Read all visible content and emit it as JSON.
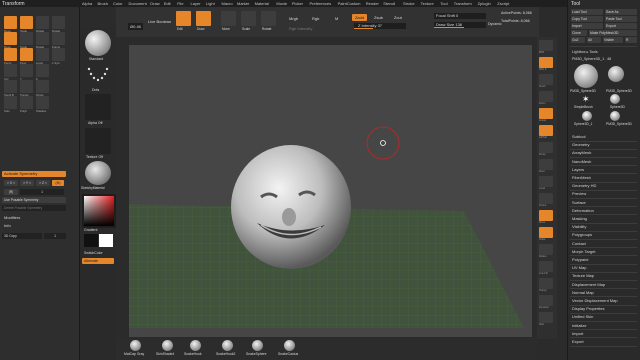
{
  "app": {
    "panel_title": "Transform",
    "right_panel_title": "Tool"
  },
  "menubar": {
    "items": [
      "Alpha",
      "Brush",
      "Color",
      "Document",
      "Draw",
      "Edit",
      "File",
      "Layer",
      "Light",
      "Macro",
      "Marker",
      "Material",
      "Movie",
      "Picker",
      "Preferences",
      "PaintCustom",
      "Render",
      "Stencil",
      "Stroke",
      "Texture",
      "Tool",
      "Transform",
      "Zplugin",
      "Zscript"
    ]
  },
  "left_panel": {
    "buttons": [
      "Move",
      "Scale",
      "Rotate",
      "Rotate",
      "Move",
      "Scale",
      "Rotate",
      "Frame",
      "Persp",
      "Floor",
      "Local",
      "L.Sym",
      "Xyz",
      "Y",
      "Z",
      "Spotlt B",
      "Transp",
      "Ghost",
      "Solo",
      "PolyF",
      "Shadow"
    ],
    "activate_symmetry": "Activate Symmetry",
    "axes": [
      "> X <",
      "> Y <",
      "> Z <",
      "(M)"
    ],
    "radial": "(R)",
    "radial_count": "1",
    "use_posable": "Use Posable Symmetry",
    "delete_posable": "Delete Posable Symmetry",
    "modifiers": "Modifiers",
    "info": "Info",
    "copy_label": "3D Copy",
    "copy_value": "1"
  },
  "tool_column": {
    "brush": "Standard",
    "stroke": "Dots",
    "alpha": "Alpha Off",
    "texture": "Texture Off",
    "material": "SketchyMaterial",
    "gradient": "Gradient",
    "switch_color": "SwitchColor",
    "alternate": "Alternate"
  },
  "top_bar": {
    "foot": "Ø0.46",
    "live_boolean": "Live Boolean",
    "modes": [
      "Edit",
      "Draw",
      "Move",
      "Scale",
      "Rotate"
    ],
    "mrgb": "Mrgb",
    "rgb": "Rgb",
    "m": "M",
    "zadd": "Zadd",
    "zsub": "Zsub",
    "zcut": "Zcut",
    "rgb_intensity": "Rgb Intensity",
    "z_intensity": "Z Intensity 37",
    "focal_shift": "Focal Shift 0",
    "draw_size": "Draw Size 136",
    "dynamic": "Dynamic",
    "active_points": "ActivePoints: 8,066",
    "total_points": "TotalPoints: 8,066"
  },
  "right_shelf": {
    "items": [
      "BPR",
      "SPix 3",
      "Scroll",
      "Zoom",
      "Actual",
      "AAHalf",
      "Persp",
      "Floor",
      "Local",
      "Frame",
      "Move",
      "Scale",
      "Rotate",
      "Line Fill",
      "Transp",
      "Dynamic",
      "Solo"
    ]
  },
  "right_panel": {
    "top_buttons": [
      "Load Tool",
      "Save As",
      "Copy Tool",
      "Paste Tool",
      "Import",
      "Export",
      "Clone",
      "Make PolyMesh3D",
      "GoZ",
      "All",
      "Visible",
      "R"
    ],
    "lightbox": "Lightbox ▸ Tools",
    "current_tool": "PM3D_Sphere3D_1 . 48",
    "thumbs": [
      "PM3D_Sphere3D",
      "SimpleBrush",
      "PM3D_Sphere3D",
      "Sphere3D",
      "Sphere3D_1",
      "PM3D_Sphere3D"
    ],
    "sections": [
      "Subtool",
      "Geometry",
      "ArrayMesh",
      "NanoMesh",
      "Layers",
      "FiberMesh",
      "Geometry HD",
      "Preview",
      "Surface",
      "Deformation",
      "Masking",
      "Visibility",
      "Polygroups",
      "Contact",
      "Morph Target",
      "Polypaint",
      "UV Map",
      "Texture Map",
      "Displacement Map",
      "Normal Map",
      "Vector Displacement Map",
      "Display Properties",
      "Unified Skin",
      "Initialize",
      "Import",
      "Export"
    ]
  },
  "bottom_bar": {
    "items": [
      "MatCap Gray",
      "SkinShade4",
      "SnakeHook",
      "SnakeHook2",
      "SnakeSphere",
      "SnakeCactus"
    ]
  },
  "colors": {
    "accent": "#e6862b",
    "panel": "#2e2e2e",
    "viewport": "#464646",
    "floor_grid": "#3e6b2e"
  }
}
